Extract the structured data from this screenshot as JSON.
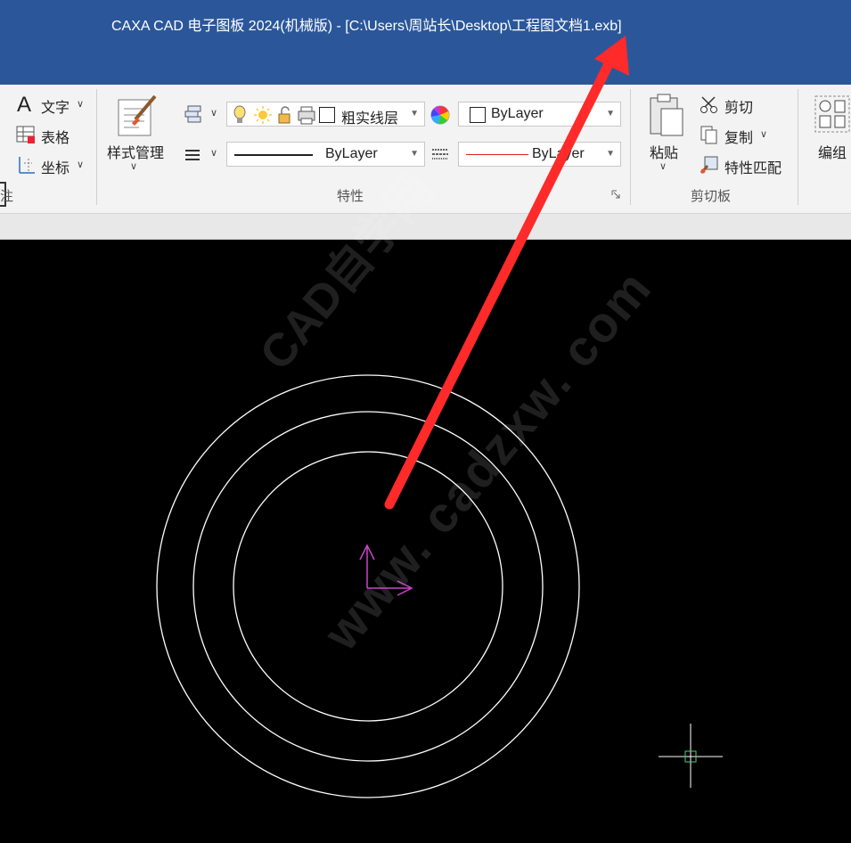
{
  "window": {
    "title": "CAXA CAD 电子图板 2024(机械版) - [C:\\Users\\周站长\\Desktop\\工程图文档1.exb]"
  },
  "ribbon": {
    "annotation_group": {
      "text_label": "文字",
      "table_label": "表格",
      "coord_label": "坐标",
      "group_label_partial": "注"
    },
    "style_manage_label": "样式管理",
    "properties": {
      "layer_value": "粗实线层",
      "color_value": "ByLayer",
      "linetype_value": "ByLayer",
      "lineweight_value": "ByLayer",
      "group_label": "特性"
    },
    "clipboard": {
      "paste_label": "粘贴",
      "cut_label": "剪切",
      "copy_label": "复制",
      "match_label": "特性匹配",
      "group_label": "剪切板"
    },
    "group_tool_label": "编组"
  },
  "canvas": {
    "background": "#000000",
    "circle_color": "#ffffff",
    "ucs_color": "#cc44cc",
    "crosshair_color": "#ffffff",
    "crosshair_box_color": "#55cc77"
  },
  "annotation_arrow": {
    "color": "#ff2a2a"
  },
  "watermark": {
    "line1": "CAD自学网",
    "line2": "www. cadzxw. com"
  }
}
